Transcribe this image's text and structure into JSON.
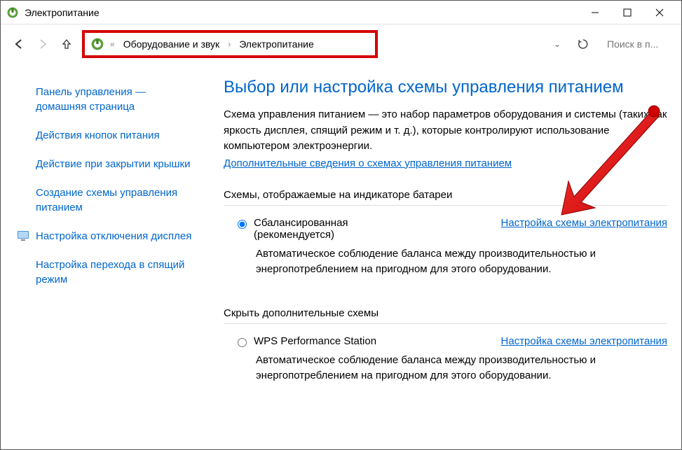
{
  "window": {
    "title": "Электропитание"
  },
  "breadcrumb": {
    "item1": "Оборудование и звук",
    "item2": "Электропитание"
  },
  "search": {
    "placeholder": "Поиск в п..."
  },
  "sidebar": {
    "home": "Панель управления — домашняя страница",
    "power_buttons": "Действия кнопок питания",
    "lid_close": "Действие при закрытии крышки",
    "create_plan": "Создание схемы управления питанием",
    "display_off": "Настройка отключения дисплея",
    "sleep": "Настройка перехода в спящий режим"
  },
  "main": {
    "title": "Выбор или настройка схемы управления питанием",
    "desc": "Схема управления питанием — это набор параметров оборудования и системы (таких как яркость дисплея, спящий режим и т. д.), которые контролируют использование компьютером электроэнергии.",
    "info_link": "Дополнительные сведения о схемах управления питанием",
    "section1": "Схемы, отображаемые на индикаторе батареи",
    "plan1_name": "Сбалансированная",
    "plan1_sub": "(рекомендуется)",
    "plan1_link": "Настройка схемы электропитания",
    "plan1_desc": "Автоматическое соблюдение баланса между производительностью и энергопотреблением на пригодном для этого оборудовании.",
    "section2": "Скрыть дополнительные схемы",
    "plan2_name": "WPS Performance Station",
    "plan2_link": "Настройка схемы электропитания",
    "plan2_desc": "Автоматическое соблюдение баланса между производительностью и энергопотреблением на пригодном для этого оборудовании."
  }
}
